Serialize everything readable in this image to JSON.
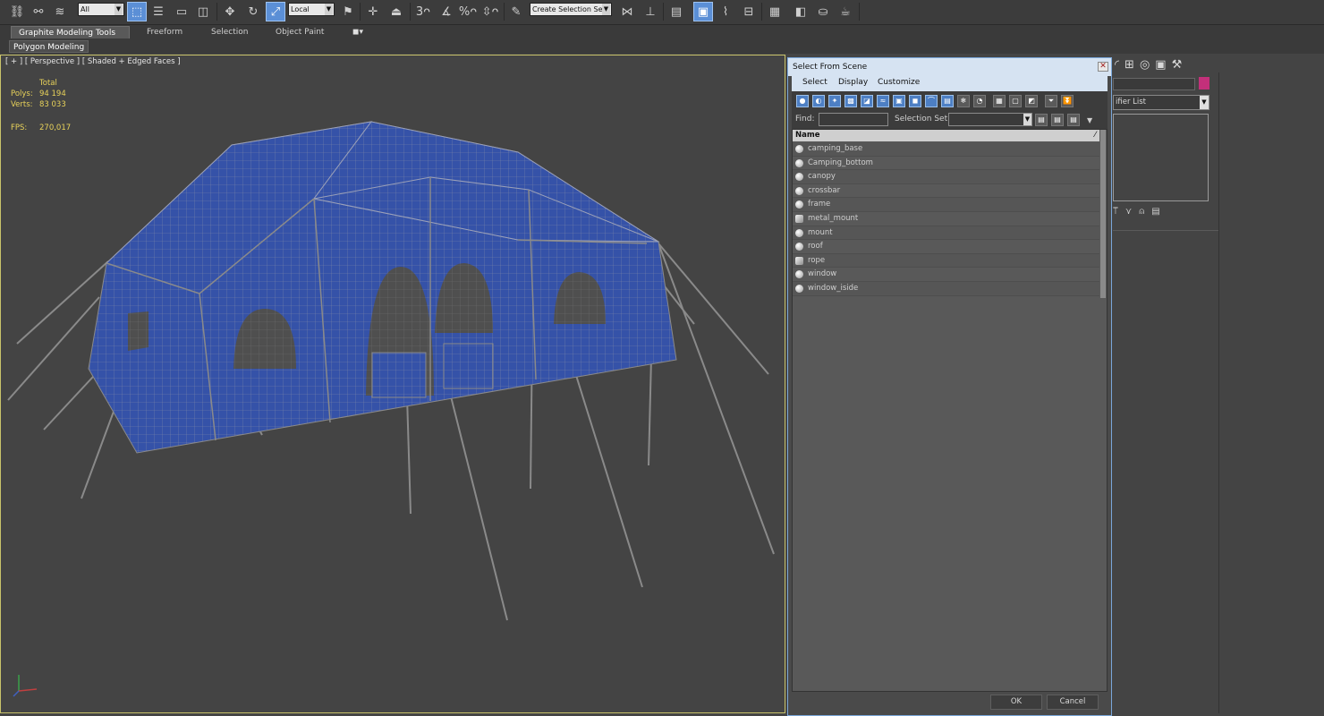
{
  "toolbar": {
    "selection_filter": "All",
    "reference_coordinate": "Local",
    "named_selection_set": "Create Selection Se"
  },
  "ribbon": {
    "tabs": [
      "Graphite Modeling Tools",
      "Freeform",
      "Selection",
      "Object Paint"
    ],
    "panel_tab": "Polygon Modeling"
  },
  "viewport": {
    "label": "[ + ] [ Perspective ] [ Shaded + Edged Faces ]",
    "stats": {
      "total_label": "Total",
      "polys_label": "Polys:",
      "polys_value": "94 194",
      "verts_label": "Verts:",
      "verts_value": "83 033",
      "fps_label": "FPS:",
      "fps_value": "270,017"
    }
  },
  "command_panel": {
    "modifier_list": "ifier List"
  },
  "dialog": {
    "title": "Select From Scene",
    "menu": [
      "Select",
      "Display",
      "Customize"
    ],
    "find_label": "Find:",
    "selection_set_label": "Selection Set:",
    "column_name": "Name",
    "objects": [
      {
        "name": "camping_base",
        "icon": "sphere-icon"
      },
      {
        "name": "Camping_bottom",
        "icon": "sphere-icon"
      },
      {
        "name": "canopy",
        "icon": "sphere-icon"
      },
      {
        "name": "crossbar",
        "icon": "sphere-icon"
      },
      {
        "name": "frame",
        "icon": "sphere-icon"
      },
      {
        "name": "metal_mount",
        "icon": "group-icon"
      },
      {
        "name": "mount",
        "icon": "sphere-icon"
      },
      {
        "name": "roof",
        "icon": "sphere-icon"
      },
      {
        "name": "rope",
        "icon": "group-icon"
      },
      {
        "name": "window",
        "icon": "sphere-icon"
      },
      {
        "name": "window_iside",
        "icon": "sphere-icon"
      }
    ],
    "ok_label": "OK",
    "cancel_label": "Cancel"
  },
  "colors": {
    "background": "#444444",
    "stat_text": "#e8d25a",
    "tent_blue": "#3552a8",
    "wire": "#8a8a8a",
    "accent": "#5b8fd6"
  }
}
